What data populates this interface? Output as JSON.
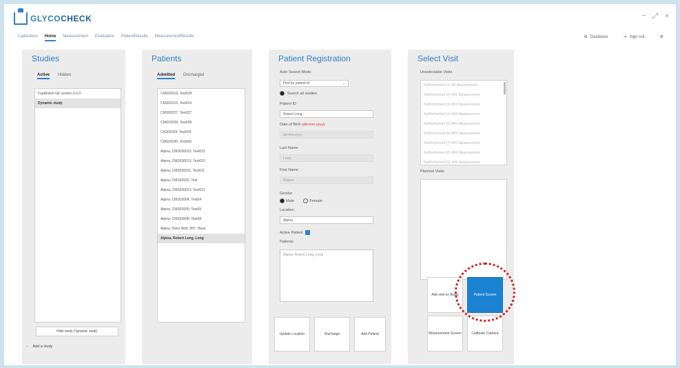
{
  "app": {
    "logo_prefix": "GLYCO",
    "logo_suffix": "CHECK",
    "window_controls": [
      "−",
      "⤢",
      "×"
    ]
  },
  "nav": {
    "tabs": [
      "Calibration",
      "Home",
      "Measurement",
      "Evaluation",
      "PatientResults",
      "MeasurementResults"
    ],
    "active_tab": "Home"
  },
  "topright": {
    "database_label": "Database",
    "signout_label": "Sign out"
  },
  "studies": {
    "title": "Studies",
    "tabs": [
      "Active",
      "Hidden"
    ],
    "items": [
      "FapiRiskm GE version 5.0.0",
      "Dynamic study"
    ],
    "selected_index": 1,
    "hide_button": "Hide study 'Dynamic study'",
    "add_study": "Add a study"
  },
  "patients": {
    "title": "Patients",
    "tabs": [
      "Admitted",
      "Discharged"
    ],
    "items": [
      "CMS02018, Test018",
      "CMS02019, Test019",
      "CMS02027, Test027",
      "CMS02028, Test028",
      "CAS02029, Test029",
      "CMS02030, Test030",
      "Alpina, CMS030023, Test023",
      "Alpina, CMS030010, Test010",
      "Alpina, CMS030011, Test011",
      "Alpina, CMS02020, Test",
      "Alpina, CMS030021, Test021",
      "Alpina, CMS02004, Test04",
      "Alpina, CMS02005, Test05",
      "Alpina, CMS02008, Test08",
      "Alpina, Hans Wolf, 897, Hans",
      "Alpina, Robert Long, Long"
    ],
    "selected_index": 15
  },
  "registration": {
    "title": "Patient Registration",
    "auto_search_label": "Auto Search Mode",
    "auto_search_value": "Find by patient id",
    "search_all_label": "Search all studies",
    "patient_id_label": "Patient ID",
    "patient_id_value": "Robert Long",
    "dob_label": "Date of Birth",
    "dob_hint": "(dd-mm-yyyy)",
    "dob_placeholder": "dd-mm-yyyy",
    "last_name_label": "Last Name",
    "last_name_value": "Long",
    "first_name_label": "First Name",
    "first_name_value": "Robert",
    "gender_label": "Gender",
    "gender_male": "Male",
    "gender_female": "Female",
    "location_label": "Location",
    "location_value": "Alpina",
    "active_patient_label": "Active Patient",
    "patients_label": "Patients",
    "patients_value": "Alpina, Robert Long, Long",
    "buttons": {
      "update": "Update Location",
      "discharge": "Discharge",
      "add": "Add Patient"
    }
  },
  "visits": {
    "title": "Select Visit",
    "unselectable_label": "Unselectable Visits",
    "unselectable_items": [
      "NotPerformed (1) 4H Measurement",
      "NotPerformed (2) 4H2 Measurement",
      "NotPerformed (3) 4H3 Measurement",
      "NotPerformed (4) 4H4 Measurement",
      "NotPerformed (5) 4H5 Measurement",
      "NotPerformed (6) 4H6 Measurement",
      "NotPerformed (7) 4H7 Measurement",
      "NotPerformed (8) 4H8 Measurement",
      "NotPerformed (9) 4H9 Measurement"
    ],
    "planned_label": "Planned Visits",
    "buttons": {
      "add_visit": "Add visit on Basis",
      "patient_screen": "Patient Screen",
      "measurement_screen": "Measurement Screen",
      "calibrate_camera": "Calibrate Camera"
    }
  },
  "colors": {
    "accent": "#2a7fd4",
    "primary_button": "#1b82d2",
    "highlight": "#d62020",
    "panel_bg": "#ececec"
  }
}
